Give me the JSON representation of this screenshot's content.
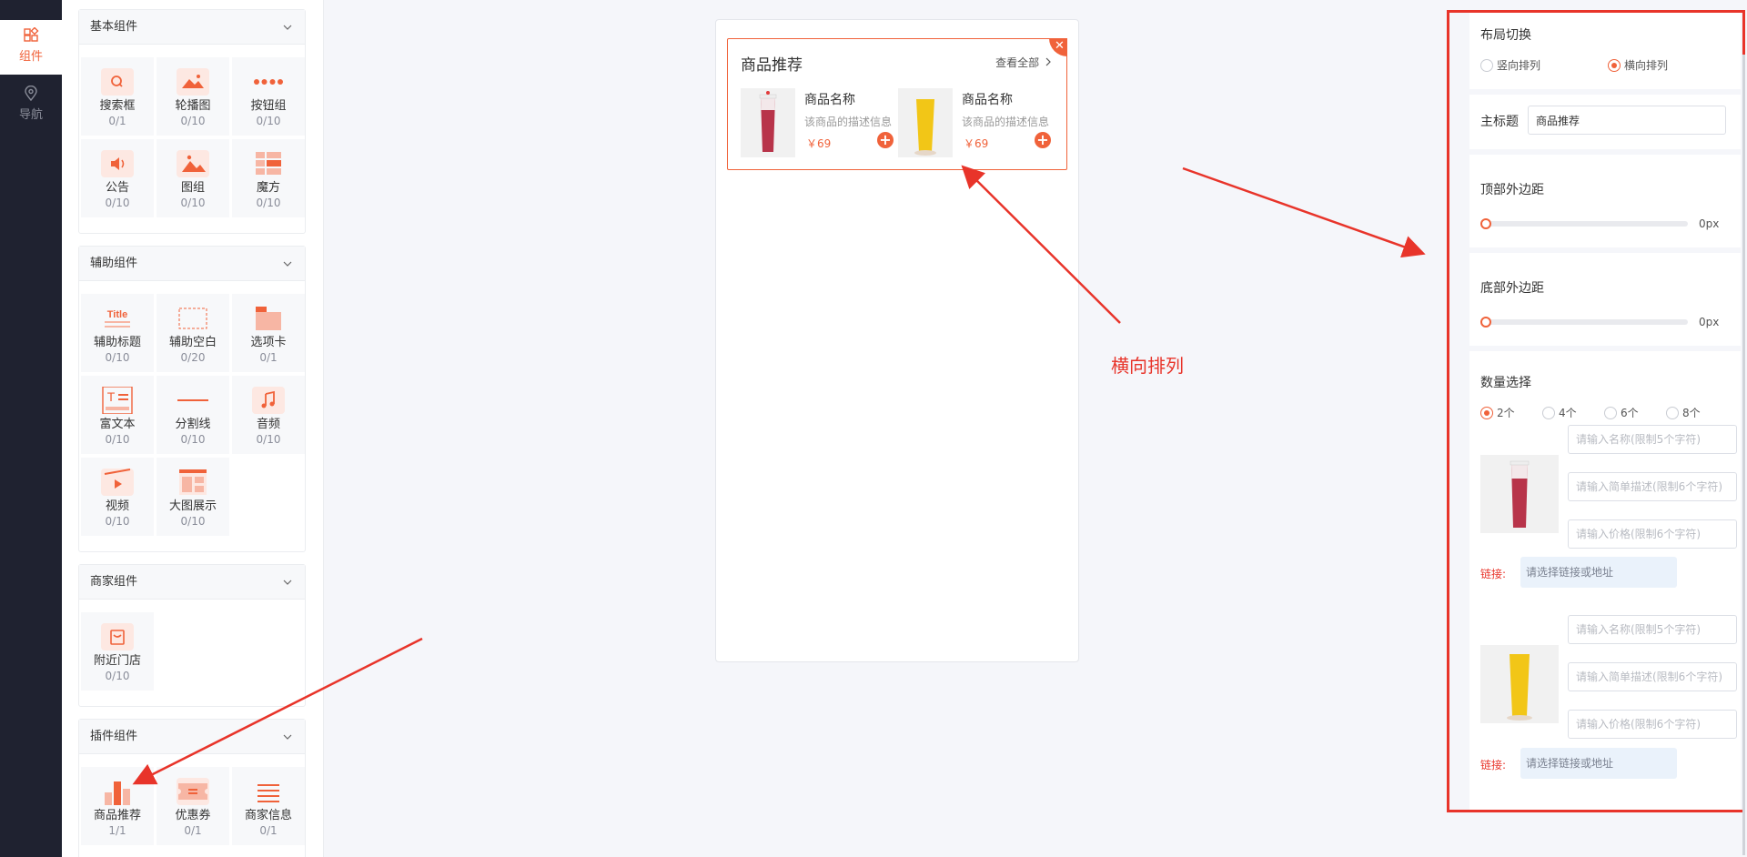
{
  "rail": {
    "items": [
      {
        "label": "组件",
        "icon": "components-icon",
        "active": true
      },
      {
        "label": "导航",
        "icon": "location-icon",
        "active": false
      }
    ]
  },
  "groups": [
    {
      "title": "基本组件",
      "items": [
        {
          "name": "搜索框",
          "count": "0/1",
          "icon": "search-icon"
        },
        {
          "name": "轮播图",
          "count": "0/10",
          "icon": "carousel-icon"
        },
        {
          "name": "按钮组",
          "count": "0/10",
          "icon": "button-group-icon"
        },
        {
          "name": "公告",
          "count": "0/10",
          "icon": "speaker-icon"
        },
        {
          "name": "图组",
          "count": "0/10",
          "icon": "image-group-icon"
        },
        {
          "name": "魔方",
          "count": "0/10",
          "icon": "cube-layout-icon"
        }
      ]
    },
    {
      "title": "辅助组件",
      "items": [
        {
          "name": "辅助标题",
          "count": "0/10",
          "icon": "title-icon"
        },
        {
          "name": "辅助空白",
          "count": "0/20",
          "icon": "blank-icon"
        },
        {
          "name": "选项卡",
          "count": "0/1",
          "icon": "tab-card-icon"
        },
        {
          "name": "富文本",
          "count": "0/10",
          "icon": "rich-text-icon"
        },
        {
          "name": "分割线",
          "count": "0/10",
          "icon": "divider-icon"
        },
        {
          "name": "音频",
          "count": "0/10",
          "icon": "music-icon"
        },
        {
          "name": "视频",
          "count": "0/10",
          "icon": "video-icon"
        },
        {
          "name": "大图展示",
          "count": "0/10",
          "icon": "large-image-icon"
        }
      ]
    },
    {
      "title": "商家组件",
      "items": [
        {
          "name": "附近门店",
          "count": "0/10",
          "icon": "store-icon"
        }
      ]
    },
    {
      "title": "插件组件",
      "items": [
        {
          "name": "商品推荐",
          "count": "1/1",
          "icon": "bar-chart-icon"
        },
        {
          "name": "优惠券",
          "count": "0/1",
          "icon": "coupon-icon"
        },
        {
          "name": "商家信息",
          "count": "0/1",
          "icon": "list-icon"
        }
      ]
    }
  ],
  "preview": {
    "title": "商品推荐",
    "view_all": "查看全部",
    "close": "✕",
    "products": [
      {
        "name": "商品名称",
        "desc": "该商品的描述信息",
        "price": "￥69",
        "add": "+",
        "color": "#b8344a"
      },
      {
        "name": "商品名称",
        "desc": "该商品的描述信息",
        "price": "￥69",
        "add": "+",
        "color": "#f2c617"
      }
    ]
  },
  "annotation": "横向排列",
  "settings": {
    "layout": {
      "label": "布局切换",
      "options": [
        {
          "label": "竖向排列",
          "selected": false
        },
        {
          "label": "横向排列",
          "selected": true
        }
      ]
    },
    "main_title": {
      "label": "主标题",
      "value": "商品推荐"
    },
    "top_margin": {
      "label": "顶部外边距",
      "value": "0px",
      "level": 0
    },
    "bottom_margin": {
      "label": "底部外边距",
      "value": "0px",
      "level": 0
    },
    "quantity": {
      "label": "数量选择",
      "options": [
        {
          "label": "2个",
          "selected": true
        },
        {
          "label": "4个",
          "selected": false
        },
        {
          "label": "6个",
          "selected": false
        },
        {
          "label": "8个",
          "selected": false
        }
      ]
    },
    "product_forms": [
      {
        "name_placeholder": "请输入名称(限制5个字符)",
        "desc_placeholder": "请输入简单描述(限制6个字符)",
        "price_placeholder": "请输入价格(限制6个字符)",
        "link_label": "链接:",
        "link_placeholder": "请选择链接或地址",
        "color": "#b8344a"
      },
      {
        "name_placeholder": "请输入名称(限制5个字符)",
        "desc_placeholder": "请输入简单描述(限制6个字符)",
        "price_placeholder": "请输入价格(限制6个字符)",
        "link_label": "链接:",
        "link_placeholder": "请选择链接或地址",
        "color": "#f2c617"
      }
    ]
  },
  "colors": {
    "accent": "#f0623a",
    "annotation": "#e8342a",
    "rail": "#1f2230"
  }
}
